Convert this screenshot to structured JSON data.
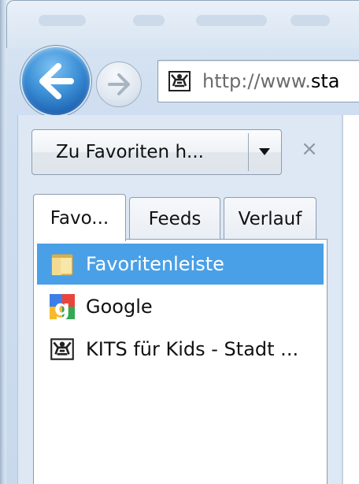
{
  "browser": {
    "address": {
      "prefix": "http://www.",
      "host": "sta"
    }
  },
  "favorites_panel": {
    "add_button_label": "Zu Favoriten h...",
    "tabs": [
      {
        "label": "Favo..."
      },
      {
        "label": "Feeds"
      },
      {
        "label": "Verlauf"
      }
    ],
    "items": [
      {
        "label": "Favoritenleiste",
        "icon": "folder-icon",
        "selected": true
      },
      {
        "label": "Google",
        "icon": "google-icon",
        "selected": false
      },
      {
        "label": "KITS für Kids - Stadt ...",
        "icon": "site-favicon-icon",
        "selected": false
      }
    ]
  },
  "colors": {
    "selection": "#4aa0e6",
    "back_button": "#1d5fae"
  }
}
